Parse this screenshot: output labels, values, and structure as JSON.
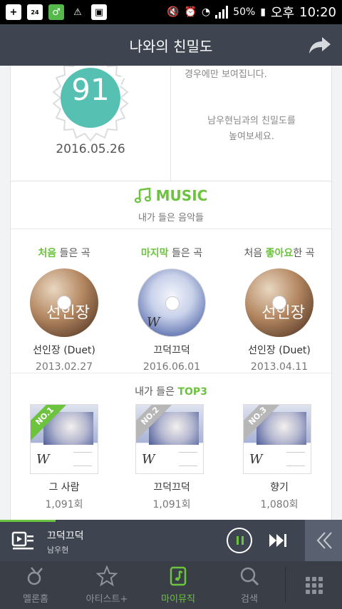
{
  "status_bar": {
    "icons": [
      "add-icon",
      "yes24-icon",
      "melon-icon",
      "warning-icon",
      "briefcase-icon"
    ],
    "right_icons": [
      "mute-icon",
      "alarm-icon",
      "wifi-icon",
      "signal-icon",
      "battery-icon"
    ],
    "battery": "50%",
    "ampm": "오후",
    "time": "10:20"
  },
  "header": {
    "title": "나와의 친밀도"
  },
  "intimacy": {
    "score": "91",
    "date": "2016.05.26",
    "partial_text": "경우에만 보여집니다.",
    "message_line1": "남우현님과의 친밀도를",
    "message_line2": "높여보세요."
  },
  "music": {
    "title": "MUSIC",
    "subtitle": "내가 들은 음악들",
    "columns": [
      {
        "label_highlight": "처음",
        "label_prefix": "",
        "label_suffix": " 들은 곡",
        "song": "선인장 (Duet)",
        "date": "2013.02.27"
      },
      {
        "label_highlight": "마지막",
        "label_prefix": "",
        "label_suffix": " 들은 곡",
        "song": "끄덕끄덕",
        "date": "2016.06.01"
      },
      {
        "label_prefix": "처음 ",
        "label_highlight": "좋아요",
        "label_suffix": "한 곡",
        "song": "선인장 (Duet)",
        "date": "2013.04.11"
      }
    ],
    "top3_prefix": "내가 들은 ",
    "top3_highlight": "TOP3",
    "top3": [
      {
        "rank": "NO.1",
        "name": "그 사람",
        "count": "1,091회"
      },
      {
        "rank": "NO.2",
        "name": "끄덕끄덕",
        "count": "1,091회"
      },
      {
        "rank": "NO.3",
        "name": "향기",
        "count": "1,080회"
      }
    ],
    "cover_text_1": "선인장",
    "cover_letter": "W"
  },
  "player": {
    "title": "끄덕끄덕",
    "artist": "남우현"
  },
  "nav": [
    {
      "label": "멜론홈"
    },
    {
      "label": "아티스트+"
    },
    {
      "label": "마이뮤직"
    },
    {
      "label": "검색"
    }
  ],
  "colors": {
    "accent": "#6cc33d",
    "header_bg": "#3e4551",
    "nav_bg": "#3a3f47"
  }
}
